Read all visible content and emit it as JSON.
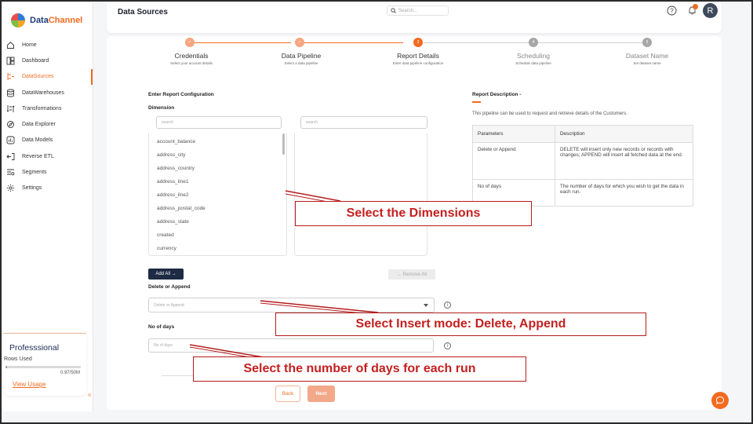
{
  "brand": {
    "part1": "Data",
    "part2": "Channel"
  },
  "sidebar": {
    "items": [
      {
        "label": "Home",
        "icon": "home-icon",
        "active": false
      },
      {
        "label": "Dashboard",
        "icon": "dashboard-icon",
        "active": false
      },
      {
        "label": "DataSources",
        "icon": "datasources-icon",
        "active": true
      },
      {
        "label": "DataWarehouses",
        "icon": "database-icon",
        "active": false
      },
      {
        "label": "Transformations",
        "icon": "transform-icon",
        "active": false
      },
      {
        "label": "Data Explorer",
        "icon": "explorer-icon",
        "active": false
      },
      {
        "label": "Data Models",
        "icon": "models-icon",
        "active": false
      },
      {
        "label": "Reverse ETL",
        "icon": "reverse-etl-icon",
        "active": false
      },
      {
        "label": "Segments",
        "icon": "segments-icon",
        "active": false
      },
      {
        "label": "Settings",
        "icon": "settings-icon",
        "active": false
      }
    ],
    "plan": {
      "name": "Professsional",
      "rows_label": "Rows Used",
      "rows_value": "0.97/50M",
      "usage_link": "View Usage",
      "rows_fraction": 0.02
    }
  },
  "header": {
    "title": "Data Sources",
    "search_placeholder": "Search..."
  },
  "user": {
    "initial": "R"
  },
  "steps": [
    {
      "title": "Credentials",
      "subtitle": "Select your account details",
      "state": "done",
      "marker": "✓"
    },
    {
      "title": "Data Pipeline",
      "subtitle": "Select a data pipeline",
      "state": "done",
      "marker": "✓"
    },
    {
      "title": "Report Details",
      "subtitle": "Enter data pipeline configuration",
      "state": "current",
      "marker": "3"
    },
    {
      "title": "Scheduling",
      "subtitle": "Schedule data pipeline",
      "state": "pending",
      "marker": "4"
    },
    {
      "title": "Dataset Name",
      "subtitle": "Set dataset name",
      "state": "pending",
      "marker": "5"
    }
  ],
  "config": {
    "section_title": "Enter Report Configuration",
    "dimension_label": "Dimension",
    "dimension_search_placeholder": "search",
    "selected_search_placeholder": "search",
    "dimensions": [
      "account_balance",
      "address_city",
      "address_country",
      "address_line1",
      "address_line2",
      "address_postal_code",
      "address_state",
      "created",
      "currency"
    ],
    "add_all": "Add All →",
    "remove_all": "← Remove All",
    "delete_append_label": "Delete or Append",
    "delete_append_placeholder": "Delete or Append",
    "days_label": "No of days",
    "days_placeholder": "No of days",
    "back": "Back",
    "next": "Next"
  },
  "description": {
    "title": "Report Description -",
    "text": "This pipeline can be used to request and retrieve details of the Customers.",
    "headers": [
      "Parameters",
      "Description"
    ],
    "rows": [
      [
        "Delete or Append",
        "DELETE will insert only new records or records with changes; APPEND will insert all fetched data at the end."
      ],
      [
        "No of days",
        "The number of days for which you wish to get the data in each run."
      ]
    ]
  },
  "annotations": {
    "dimensions": "Select the Dimensions",
    "insert_mode": "Select Insert mode: Delete, Append",
    "days": "Select the number of days for each run"
  },
  "colors": {
    "accent": "#f26b21",
    "dark": "#1e2b45",
    "callout": "#c42020"
  }
}
